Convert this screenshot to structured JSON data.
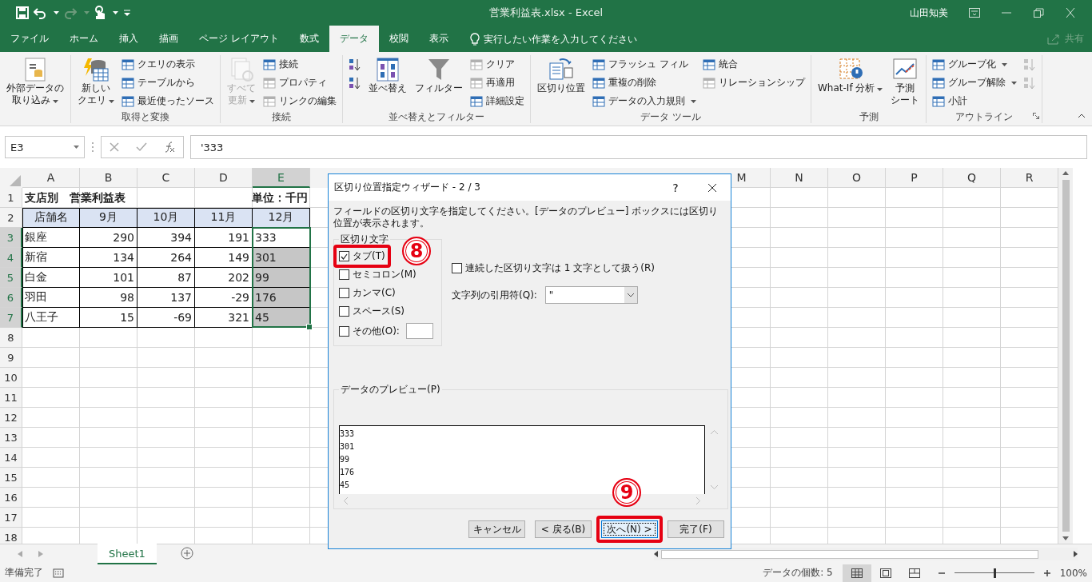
{
  "window": {
    "title": "営業利益表.xlsx  -  Excel",
    "user": "山田知美"
  },
  "ribbon_tabs": [
    {
      "label": "ファイル",
      "selected": false
    },
    {
      "label": "ホーム",
      "selected": false
    },
    {
      "label": "挿入",
      "selected": false
    },
    {
      "label": "描画",
      "selected": false
    },
    {
      "label": "ページ レイアウト",
      "selected": false
    },
    {
      "label": "数式",
      "selected": false
    },
    {
      "label": "データ",
      "selected": true
    },
    {
      "label": "校閲",
      "selected": false
    },
    {
      "label": "表示",
      "selected": false
    }
  ],
  "tell_me": {
    "placeholder": "実行したい作業を入力してください"
  },
  "share": {
    "label": "共有",
    "disabled": true
  },
  "ribbon_groups": [
    {
      "dialog_launcher": false,
      "columns": [
        {
          "kind": "large",
          "label_lines": [
            "外部データの",
            "取り込み"
          ],
          "dropdown": true,
          "disabled": false
        }
      ]
    },
    {
      "label": "取得と変換",
      "dialog_launcher": false,
      "columns": [
        {
          "kind": "large",
          "label_lines": [
            "新しい",
            "クエリ"
          ],
          "dropdown": true,
          "disabled": false
        },
        {
          "kind": "stack",
          "items": [
            {
              "label": "クエリの表示",
              "dropdown": false,
              "disabled": false
            },
            {
              "label": "テーブルから",
              "dropdown": false,
              "disabled": false
            },
            {
              "label": "最近使ったソース",
              "dropdown": false,
              "disabled": false
            }
          ]
        }
      ]
    },
    {
      "label": "接続",
      "dialog_launcher": false,
      "columns": [
        {
          "kind": "large",
          "label_lines": [
            "すべて",
            "更新"
          ],
          "dropdown": true,
          "disabled": true
        },
        {
          "kind": "stack",
          "items": [
            {
              "label": "接続",
              "dropdown": false,
              "disabled": false
            },
            {
              "label": "プロパティ",
              "dropdown": false,
              "disabled": true
            },
            {
              "label": "リンクの編集",
              "dropdown": false,
              "disabled": true
            }
          ]
        }
      ]
    },
    {
      "label": "並べ替えとフィルター",
      "dialog_launcher": false,
      "columns": [
        {
          "kind": "stack",
          "items": [
            {
              "dropdown": false,
              "disabled": false
            },
            {
              "dropdown": false,
              "disabled": false
            }
          ]
        },
        {
          "kind": "large",
          "label_lines": [
            "並べ替え"
          ],
          "dropdown": false,
          "disabled": false
        },
        {
          "kind": "large",
          "label_lines": [
            "フィルター"
          ],
          "dropdown": false,
          "disabled": false
        },
        {
          "kind": "stack",
          "items": [
            {
              "label": "クリア",
              "dropdown": false,
              "disabled": true
            },
            {
              "label": "再適用",
              "dropdown": false,
              "disabled": true
            },
            {
              "label": "詳細設定",
              "dropdown": false,
              "disabled": false
            }
          ]
        }
      ]
    },
    {
      "label": "データ ツール",
      "dialog_launcher": false,
      "columns": [
        {
          "kind": "large",
          "label_lines": [
            "区切り位置"
          ],
          "dropdown": false,
          "disabled": false
        },
        {
          "kind": "stack",
          "items": [
            {
              "label": "フラッシュ フィル",
              "dropdown": false,
              "disabled": false
            },
            {
              "label": "重複の削除",
              "dropdown": false,
              "disabled": false
            },
            {
              "label": "データの入力規則",
              "dropdown": true,
              "disabled": false
            }
          ]
        },
        {
          "kind": "stack",
          "items": [
            {
              "label": "統合",
              "dropdown": false,
              "disabled": false
            },
            {
              "label": "リレーションシップ",
              "dropdown": false,
              "disabled": true
            }
          ]
        }
      ]
    },
    {
      "label": "予測",
      "dialog_launcher": false,
      "columns": [
        {
          "kind": "large",
          "label_lines": [
            "What-If 分析"
          ],
          "dropdown": true,
          "disabled": false
        },
        {
          "kind": "large",
          "label_lines": [
            "予測",
            "シート"
          ],
          "dropdown": false,
          "disabled": false
        }
      ]
    },
    {
      "label": "アウトライン",
      "dialog_launcher": true,
      "columns": [
        {
          "kind": "stack",
          "items": [
            {
              "label": "グループ化",
              "dropdown": true,
              "disabled": false
            },
            {
              "label": "グループ解除",
              "dropdown": true,
              "disabled": false
            },
            {
              "label": "小計",
              "dropdown": false,
              "disabled": false
            }
          ]
        },
        {
          "kind": "stack",
          "items": [
            {
              "dropdown": false,
              "disabled": true
            },
            {
              "dropdown": false,
              "disabled": true
            }
          ]
        }
      ]
    }
  ],
  "formula_bar": {
    "name_box": "E3",
    "formula": "'333"
  },
  "columns_left": [
    "A",
    "B",
    "C",
    "D",
    "E"
  ],
  "columns_right": [
    "M",
    "N",
    "O",
    "P",
    "Q",
    "R"
  ],
  "row_numbers": [
    "1",
    "2",
    "3",
    "4",
    "5",
    "6",
    "7",
    "8",
    "9",
    "10",
    "11",
    "12",
    "13",
    "14",
    "15",
    "16",
    "17",
    "18"
  ],
  "sheet": {
    "title": "支店別　営業利益表",
    "unit": "単位：千円",
    "header": [
      "店舗名",
      "9月",
      "10月",
      "11月",
      "12月"
    ],
    "rows": [
      {
        "cells": [
          "銀座",
          "290",
          "394",
          "191",
          "333"
        ],
        "selected": true,
        "active": true
      },
      {
        "cells": [
          "新宿",
          "134",
          "264",
          "149",
          "301"
        ],
        "selected": true,
        "active": false
      },
      {
        "cells": [
          "白金",
          "101",
          "87",
          "202",
          "99"
        ],
        "selected": true,
        "active": false
      },
      {
        "cells": [
          "羽田",
          "98",
          "137",
          "-29",
          "176"
        ],
        "selected": true,
        "active": false
      },
      {
        "cells": [
          "八王子",
          "15",
          "-69",
          "321",
          "45"
        ],
        "selected": true,
        "active": false
      }
    ]
  },
  "dialog": {
    "title": "区切り位置指定ウィザード - 2 / 3",
    "help": "?",
    "instruction": "フィールドの区切り文字を指定してください。[データのプレビュー] ボックスには区切り位置が表示されます。",
    "delimiters": {
      "legend": "区切り文字",
      "options": [
        {
          "kind": "plain",
          "label": "タブ(T)",
          "checked": true,
          "highlighted": true
        },
        {
          "kind": "plain",
          "label": "セミコロン(M)",
          "checked": false,
          "highlighted": false
        },
        {
          "kind": "plain",
          "label": "カンマ(C)",
          "checked": false,
          "highlighted": false
        },
        {
          "kind": "plain",
          "label": "スペース(S)",
          "checked": false,
          "highlighted": false
        },
        {
          "kind": "with_field",
          "label": "その他(O):",
          "checked": false,
          "highlighted": false
        }
      ]
    },
    "consecutive": {
      "label": "連続した区切り文字は 1 文字として扱う(R)",
      "checked": false
    },
    "qualifier": {
      "label": "文字列の引用符(Q):",
      "value": "\""
    },
    "preview": {
      "legend": "データのプレビュー(P)",
      "lines": [
        "333",
        "301",
        "99",
        "176",
        "45"
      ]
    },
    "buttons": [
      {
        "label": "キャンセル",
        "default": false,
        "highlighted": false
      },
      {
        "label": "< 戻る(B)",
        "default": false,
        "highlighted": false
      },
      {
        "label": "次へ(N) >",
        "default": true,
        "highlighted": true
      },
      {
        "label": "完了(F)",
        "default": false,
        "highlighted": false
      }
    ],
    "annotations": [
      {
        "number": "8"
      },
      {
        "number": "9"
      }
    ]
  },
  "sheet_tabs": [
    {
      "label": "Sheet1",
      "selected": true
    }
  ],
  "status_bar": {
    "ready": "準備完了",
    "count": "データの個数: 5",
    "zoom": "100%",
    "zoom_slider": {
      "level": 0.5
    }
  }
}
